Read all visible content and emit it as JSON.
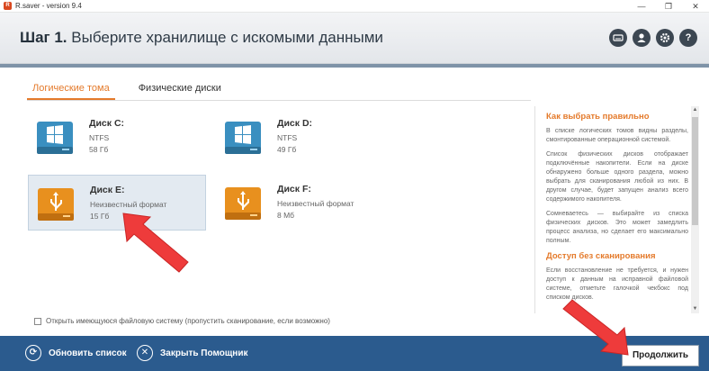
{
  "window": {
    "title": "R.saver - version 9.4",
    "app_icon": "R",
    "minimize": "—",
    "maximize": "❐",
    "close": "✕"
  },
  "header": {
    "step": "Шаг 1.",
    "title": "Выберите хранилище с искомыми данными",
    "icons": [
      "keyboard-icon",
      "user-icon",
      "gear-icon",
      "help-icon"
    ]
  },
  "tabs": [
    {
      "label": "Логические тома",
      "active": true
    },
    {
      "label": "Физические диски",
      "active": false
    }
  ],
  "disks": [
    {
      "name": "Диск C:",
      "fs": "NTFS",
      "size": "58 Гб",
      "type": "windows",
      "selected": false
    },
    {
      "name": "Диск D:",
      "fs": "NTFS",
      "size": "49 Гб",
      "type": "windows",
      "selected": false
    },
    {
      "name": "Диск E:",
      "fs": "Неизвестный формат",
      "size": "15 Гб",
      "type": "usb",
      "selected": true
    },
    {
      "name": "Диск F:",
      "fs": "Неизвестный формат",
      "size": "8 Мб",
      "type": "usb",
      "selected": false
    }
  ],
  "checkbox": {
    "label": "Открыть имеющуюся файловую систему (пропустить сканирование, если возможно)",
    "checked": false
  },
  "help": {
    "title1": "Как выбрать правильно",
    "p1": "В списке логических томов видны разделы, смонтированные операционной системой.",
    "p2": "Список физических дисков отображает подключённые накопители. Если на диске обнаружено больше одного раздела, можно выбрать для сканирования любой из них. В другом случае, будет запущен анализ всего содержимого накопителя.",
    "p3": "Сомневаетесь — выбирайте из списка физических дисков. Это может замедлить процесс анализа, но сделает его максимально полным.",
    "title2": "Доступ без сканирования",
    "p4": "Если восстановление не требуется, и нужен доступ к данным на исправной файловой системе, отметьте галочкой чекбокс под списком дисков."
  },
  "footer": {
    "refresh": "Обновить список",
    "close": "Закрыть Помощник",
    "continue": "Продолжить"
  },
  "colors": {
    "accent": "#e47a2b",
    "footer": "#2b5b8e",
    "arrow": "#ee3b3b"
  }
}
